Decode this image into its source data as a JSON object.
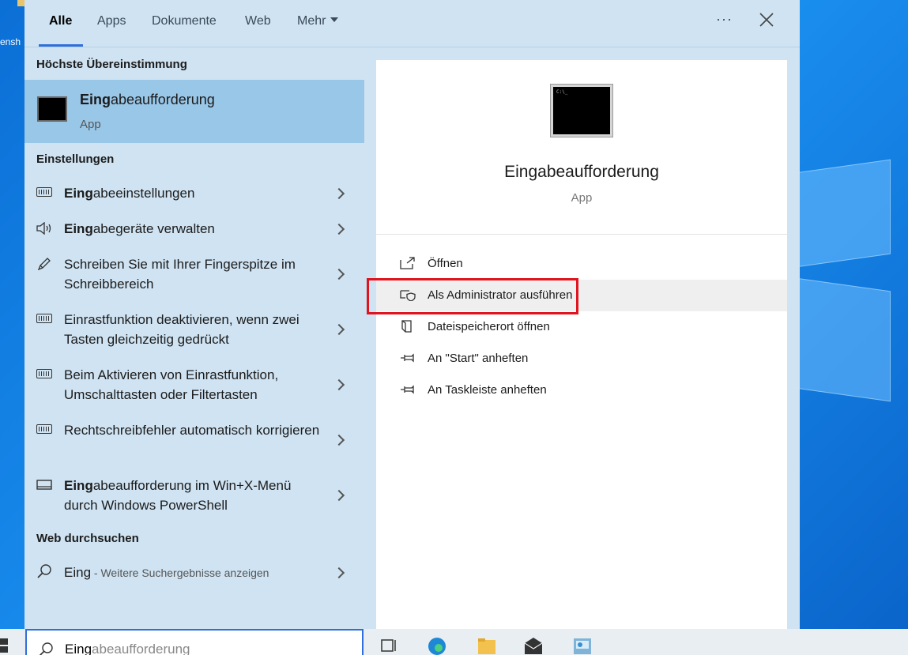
{
  "desktop": {
    "icon_label": "ensh"
  },
  "tabs": [
    {
      "label": "Alle",
      "active": true
    },
    {
      "label": "Apps",
      "active": false
    },
    {
      "label": "Dokumente",
      "active": false
    },
    {
      "label": "Web",
      "active": false
    },
    {
      "label": "Mehr",
      "active": false
    }
  ],
  "sections": {
    "best_match": "Höchste Übereinstimmung",
    "settings": "Einstellungen",
    "web": "Web durchsuchen"
  },
  "best_match": {
    "title_bold": "Eing",
    "title_rest": "abeaufforderung",
    "subtitle": "App"
  },
  "settings_items": [
    {
      "bold": "Eing",
      "rest": "abeeinstellungen",
      "icon": "keyboard-icon"
    },
    {
      "bold": "Eing",
      "rest": "abegeräte verwalten",
      "icon": "speaker-icon"
    },
    {
      "bold": "",
      "rest": "Schreiben Sie mit Ihrer Fingerspitze im Schreibbereich",
      "icon": "pen-icon"
    },
    {
      "bold": "",
      "rest": "Einrastfunktion deaktivieren, wenn zwei Tasten gleichzeitig gedrückt",
      "icon": "keyboard-icon"
    },
    {
      "bold": "",
      "rest": "Beim Aktivieren von Einrastfunktion, Umschalttasten oder Filtertasten",
      "icon": "keyboard-icon"
    },
    {
      "bold": "",
      "rest": "Rechtschreibfehler automatisch korrigieren",
      "icon": "keyboard-icon"
    },
    {
      "bold": "Eing",
      "rest": "abeaufforderung im Win+X-Menü durch Windows PowerShell",
      "icon": "monitor-icon"
    }
  ],
  "web_item": {
    "query": "Eing",
    "hint": " - Weitere Suchergebnisse anzeigen"
  },
  "detail": {
    "title": "Eingabeaufforderung",
    "subtitle": "App",
    "icon_text": "C:\\_",
    "actions": [
      {
        "label": "Öffnen",
        "icon": "open-icon"
      },
      {
        "label": "Als Administrator ausführen",
        "icon": "shield-icon"
      },
      {
        "label": "Dateispeicherort öffnen",
        "icon": "file-location-icon"
      },
      {
        "label": "An \"Start\" anheften",
        "icon": "pin-icon"
      },
      {
        "label": "An Taskleiste anheften",
        "icon": "pin-icon"
      }
    ]
  },
  "taskbar": {
    "search_typed": "Eing",
    "search_suggest": "abeaufforderung"
  },
  "colors": {
    "panel_bg": "#cfe3f2",
    "selected_bg": "#99c7e8",
    "accent": "#2f6fdb",
    "highlight_box": "#e0141e"
  }
}
